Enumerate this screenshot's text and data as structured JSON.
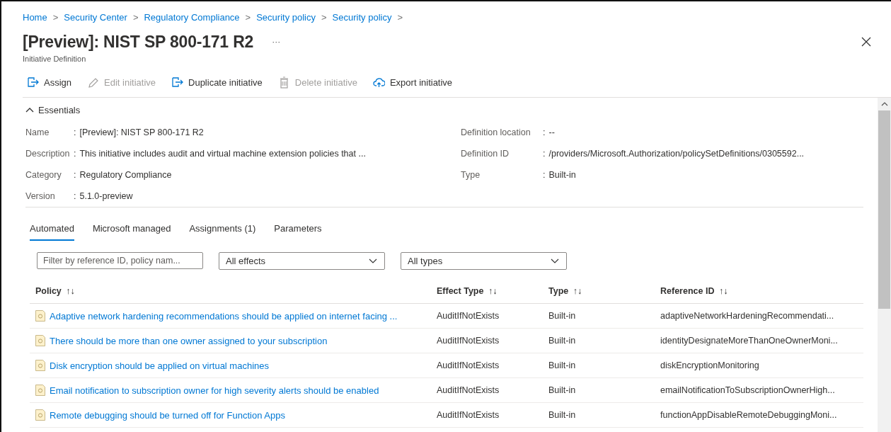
{
  "breadcrumb": [
    "Home",
    "Security Center",
    "Regulatory Compliance",
    "Security policy",
    "Security policy"
  ],
  "breadcrumb_separator": ">",
  "title": "[Preview]: NIST SP 800-171 R2",
  "title_more": "···",
  "subtitle": "Initiative Definition",
  "toolbar": [
    {
      "label": "Assign",
      "kind": "assign",
      "disabled": false
    },
    {
      "label": "Edit initiative",
      "kind": "edit",
      "disabled": true
    },
    {
      "label": "Duplicate initiative",
      "kind": "assign",
      "disabled": false
    },
    {
      "label": "Delete initiative",
      "kind": "delete",
      "disabled": true
    },
    {
      "label": "Export initiative",
      "kind": "export",
      "disabled": false
    }
  ],
  "essentials": {
    "label": "Essentials",
    "expanded": true,
    "separator": ":",
    "left": [
      {
        "label": "Name",
        "value": "[Preview]: NIST SP 800-171 R2"
      },
      {
        "label": "Description",
        "value": "This initiative includes audit and virtual machine extension policies that ..."
      },
      {
        "label": "Category",
        "value": "Regulatory Compliance"
      },
      {
        "label": "Version",
        "value": "5.1.0-preview"
      }
    ],
    "right": [
      {
        "label": "Definition location",
        "value": "--"
      },
      {
        "label": "Definition ID",
        "value": "/providers/Microsoft.Authorization/policySetDefinitions/0305592..."
      },
      {
        "label": "Type",
        "value": "Built-in"
      }
    ]
  },
  "tabs": [
    {
      "label": "Automated",
      "selected": true
    },
    {
      "label": "Microsoft managed",
      "selected": false
    },
    {
      "label": "Assignments (1)",
      "selected": false
    },
    {
      "label": "Parameters",
      "selected": false
    }
  ],
  "filters": {
    "search": {
      "placeholder": "Filter by reference ID, policy nam..."
    },
    "dropdowns": [
      {
        "value": "All effects"
      },
      {
        "value": "All types"
      }
    ]
  },
  "table": {
    "sort_mark": "↑↓",
    "columns": [
      "Policy",
      "Effect Type",
      "Type",
      "Reference ID"
    ],
    "rows": [
      [
        "Adaptive network hardening recommendations should be applied on internet facing ...",
        "AuditIfNotExists",
        "Built-in",
        "adaptiveNetworkHardeningRecommendati..."
      ],
      [
        "There should be more than one owner assigned to your subscription",
        "AuditIfNotExists",
        "Built-in",
        "identityDesignateMoreThanOneOwnerMoni..."
      ],
      [
        "Disk encryption should be applied on virtual machines",
        "AuditIfNotExists",
        "Built-in",
        "diskEncryptionMonitoring"
      ],
      [
        "Email notification to subscription owner for high severity alerts should be enabled",
        "AuditIfNotExists",
        "Built-in",
        "emailNotificationToSubscriptionOwnerHigh..."
      ],
      [
        "Remote debugging should be turned off for Function Apps",
        "AuditIfNotExists",
        "Built-in",
        "functionAppDisableRemoteDebuggingMoni..."
      ]
    ]
  }
}
